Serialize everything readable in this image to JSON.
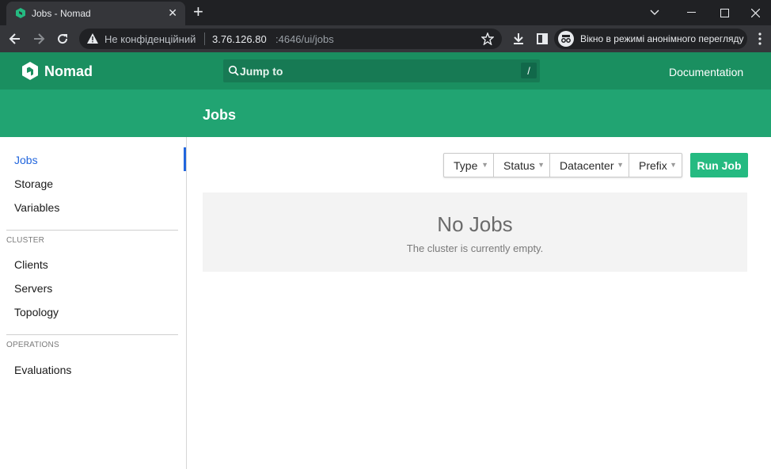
{
  "browser": {
    "tab_title": "Jobs - Nomad",
    "tab_close": "✕",
    "new_tab": "+",
    "window_controls": {
      "minimize": "—",
      "maximize": "☐",
      "close": "✕"
    },
    "security_label": "Не конфіденційний",
    "url_host": "3.76.126.80",
    "url_path": ":4646/ui/jobs",
    "incognito_label": "Вікно в режимі анонімного перегляду",
    "icons": [
      "back-icon",
      "forward-icon",
      "reload-icon",
      "warning-icon",
      "star-icon",
      "download-icon",
      "sidepanel-icon",
      "incognito-icon",
      "more-icon"
    ]
  },
  "header": {
    "brand": "Nomad",
    "search_placeholder": "Jump to",
    "search_shortcut": "/",
    "documentation": "Documentation",
    "accent": "#1a8f60"
  },
  "page": {
    "title": "Jobs"
  },
  "sidebar": {
    "items": [
      {
        "label": "Jobs",
        "active": true
      },
      {
        "label": "Storage"
      },
      {
        "label": "Variables"
      }
    ],
    "cluster_label": "CLUSTER",
    "cluster_items": [
      {
        "label": "Clients"
      },
      {
        "label": "Servers"
      },
      {
        "label": "Topology"
      }
    ],
    "operations_label": "OPERATIONS",
    "operations_items": [
      {
        "label": "Evaluations"
      }
    ]
  },
  "main": {
    "filters": [
      {
        "label": "Type"
      },
      {
        "label": "Status"
      },
      {
        "label": "Datacenter"
      },
      {
        "label": "Prefix"
      }
    ],
    "filter_caret": "▼",
    "run_job": "Run Job",
    "empty_title": "No Jobs",
    "empty_message": "The cluster is currently empty.",
    "run_job_color": "#25ba81"
  }
}
